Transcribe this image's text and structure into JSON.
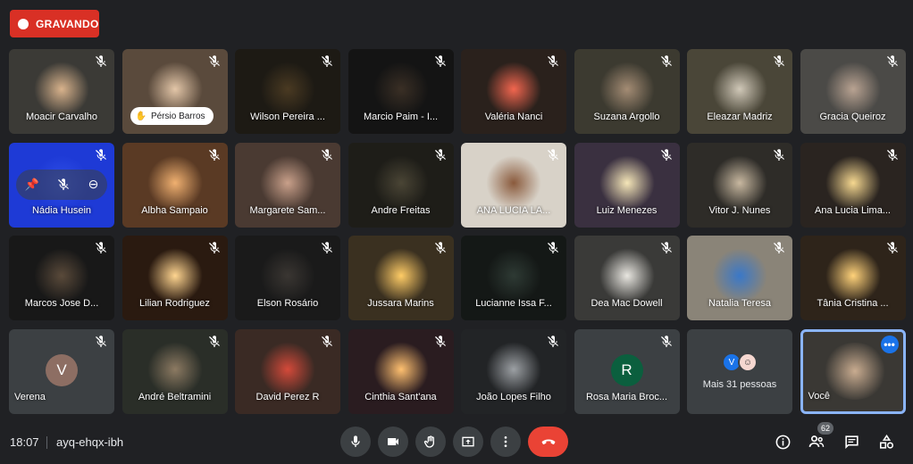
{
  "recording": {
    "label": "GRAVANDO"
  },
  "participants": [
    {
      "name": "Moacir Carvalho",
      "bg": "#3b3a36",
      "glow": "#d9b38c"
    },
    {
      "name": "Pérsio Barros",
      "bg": "#5a4a3c",
      "glow": "#e3c6a8"
    },
    {
      "name": "Wilson Pereira ...",
      "bg": "#1d1a14",
      "glow": "#4a3a22"
    },
    {
      "name": "Marcio Paim - I...",
      "bg": "#141414",
      "glow": "#3a2f25"
    },
    {
      "name": "Valéria Nanci",
      "bg": "#2a211c",
      "glow": "#f2664f"
    },
    {
      "name": "Suzana Argollo",
      "bg": "#3c3a30",
      "glow": "#a48c74"
    },
    {
      "name": "Eleazar Madriz",
      "bg": "#4a4638",
      "glow": "#d0c8b8"
    },
    {
      "name": "Gracia Queiroz",
      "bg": "#4b4a47",
      "glow": "#b9a392"
    },
    {
      "name": "Nádia Husein",
      "bg": "#1e3ad6",
      "glow": "#2f4fe8"
    },
    {
      "name": "Albha Sampaio",
      "bg": "#5a3a24",
      "glow": "#f0b070"
    },
    {
      "name": "Margarete Sam...",
      "bg": "#4a3a32",
      "glow": "#c9a08a"
    },
    {
      "name": "Andre Freitas",
      "bg": "#1e1d18",
      "glow": "#4a4535"
    },
    {
      "name": "ANA LUCIA LA...",
      "bg": "#d8d2c8",
      "glow": "#8a5a3c"
    },
    {
      "name": "Luiz Menezes",
      "bg": "#3a3040",
      "glow": "#f5e6b8"
    },
    {
      "name": "Vitor J. Nunes",
      "bg": "#2e2c28",
      "glow": "#c8b8a0"
    },
    {
      "name": "Ana Lucia Lima...",
      "bg": "#2a2420",
      "glow": "#f6d890"
    },
    {
      "name": "Marcos Jose D...",
      "bg": "#181818",
      "glow": "#5a4a3a"
    },
    {
      "name": "Lilian Rodriguez",
      "bg": "#2a1a10",
      "glow": "#ffd590"
    },
    {
      "name": "Elson Rosário",
      "bg": "#1a1a1a",
      "glow": "#3a3632"
    },
    {
      "name": "Jussara Marins",
      "bg": "#3a3020",
      "glow": "#ffcc66"
    },
    {
      "name": "Lucianne Issa F...",
      "bg": "#141816",
      "glow": "#2e3a34"
    },
    {
      "name": "Dea Mac Dowell",
      "bg": "#3a3a38",
      "glow": "#e8e6e0"
    },
    {
      "name": "Natalia Teresa",
      "bg": "#8a8478",
      "glow": "#3a78c8"
    },
    {
      "name": "Tânia Cristina ...",
      "bg": "#2e241a",
      "glow": "#ffd27a"
    },
    {
      "name": "André Beltramini",
      "bg": "#2a2e28",
      "glow": "#8c7a62"
    },
    {
      "name": "David Perez R",
      "bg": "#3a2a24",
      "glow": "#d44a3a"
    },
    {
      "name": "Cinthia Sant'ana",
      "bg": "#2a1c20",
      "glow": "#ffc070"
    },
    {
      "name": "João Lopes Filho",
      "bg": "#222426",
      "glow": "#9ca0a4"
    }
  ],
  "avatar_tiles": [
    {
      "name": "Verena",
      "initial": "V",
      "color": "#8d6e63"
    },
    {
      "name": "Rosa Maria Broc...",
      "initial": "R",
      "color": "#0b5f3e"
    }
  ],
  "more_tile": {
    "label": "Mais 31 pessoas",
    "avatar_initial": "V",
    "avatar_color": "#1a73e8"
  },
  "self_tile": {
    "name": "Você",
    "bg": "#3a3834"
  },
  "bottom_bar": {
    "time": "18:07",
    "meeting_code": "ayq-ehqx-ibh",
    "people_count": "62"
  },
  "colors": {
    "end_call": "#ea4335",
    "recording": "#d93025",
    "self_border": "#8ab4f8"
  }
}
